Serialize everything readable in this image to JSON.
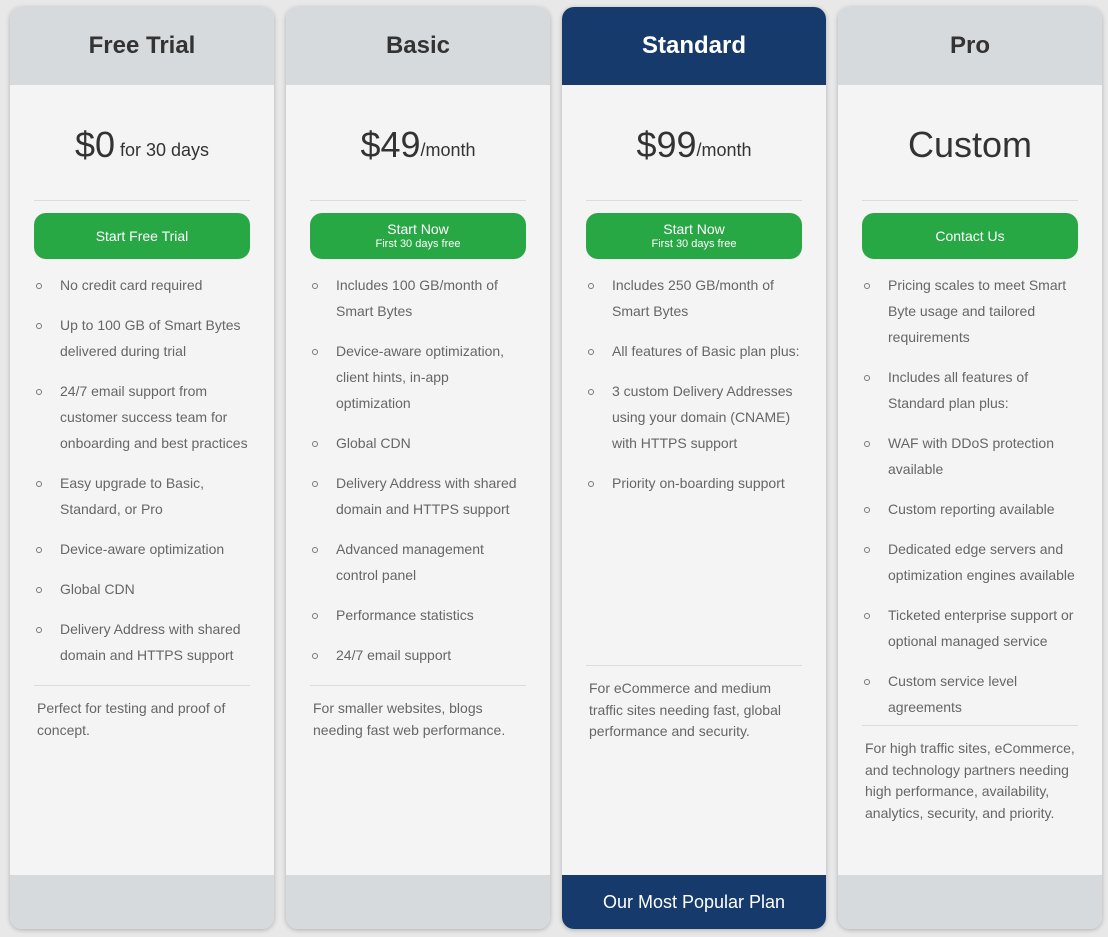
{
  "plans": [
    {
      "name": "Free Trial",
      "price": "$0",
      "unit": "for 30 days",
      "cta_label": "Start Free Trial",
      "cta_sublabel": "",
      "features": [
        "No credit card required",
        "Up to 100 GB of Smart Bytes delivered during trial",
        "24/7 email support from customer success team for onboarding and best practices",
        "Easy upgrade to Basic, Standard, or Pro",
        "Device-aware optimization",
        "Global CDN",
        "Delivery Address with shared domain and HTTPS support"
      ],
      "description": "Perfect for testing and proof of concept.",
      "footer": ""
    },
    {
      "name": "Basic",
      "price": "$49",
      "unit": "/month",
      "cta_label": "Start Now",
      "cta_sublabel": "First 30 days free",
      "features": [
        "Includes 100 GB/month of Smart Bytes",
        "Device-aware optimization, client hints, in-app optimization",
        "Global CDN",
        "Delivery Address with shared domain and HTTPS support",
        "Advanced management control panel",
        "Performance statistics",
        "24/7 email support"
      ],
      "description": "For smaller websites, blogs needing fast web performance.",
      "footer": ""
    },
    {
      "name": "Standard",
      "price": "$99",
      "unit": "/month",
      "cta_label": "Start Now",
      "cta_sublabel": "First 30 days free",
      "features": [
        "Includes 250 GB/month of Smart Bytes",
        "All features of Basic plan plus:",
        "3 custom Delivery Addresses using your domain (CNAME) with HTTPS support",
        "Priority on-boarding support"
      ],
      "description": "For eCommerce and medium traffic sites needing fast, global performance and security.",
      "footer": "Our Most Popular Plan",
      "featured": true
    },
    {
      "name": "Pro",
      "price": "Custom",
      "unit": "",
      "cta_label": "Contact Us",
      "cta_sublabel": "",
      "features": [
        "Pricing scales to meet Smart Byte usage and tailored requirements",
        "Includes all features of Standard plan plus:",
        "WAF with DDoS protection available",
        "Custom reporting available",
        "Dedicated edge servers and optimization engines available",
        "Ticketed enterprise support or optional managed service",
        "Custom service level agreements"
      ],
      "description": "For high traffic sites, eCommerce, and technology partners needing high performance, availability, analytics, security, and priority.",
      "footer": ""
    }
  ],
  "colors": {
    "featured_header": "#163a6b",
    "header": "#d7dadd",
    "cta": "#28a745",
    "card_body": "#f4f4f4"
  }
}
